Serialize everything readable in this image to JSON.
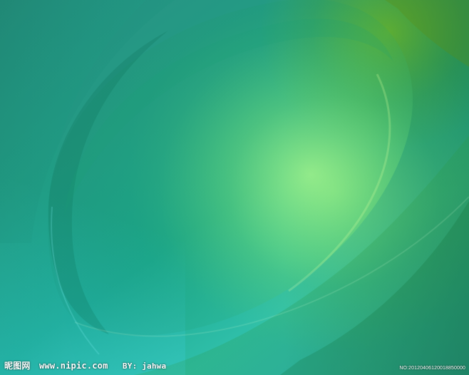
{
  "image": {
    "theme": "abstract green-blue curved wallpaper",
    "colors": {
      "deep_green": "#1f8a5a",
      "teal": "#21a58b",
      "cyan": "#45cde3",
      "lime_glow": "#a8ef73",
      "yellow_green": "#8ebc13"
    }
  },
  "watermark": {
    "brand": "昵图网",
    "site": "www.nipic.com",
    "author": "BY: jahwa",
    "number": "NO:20120406120018850000"
  }
}
